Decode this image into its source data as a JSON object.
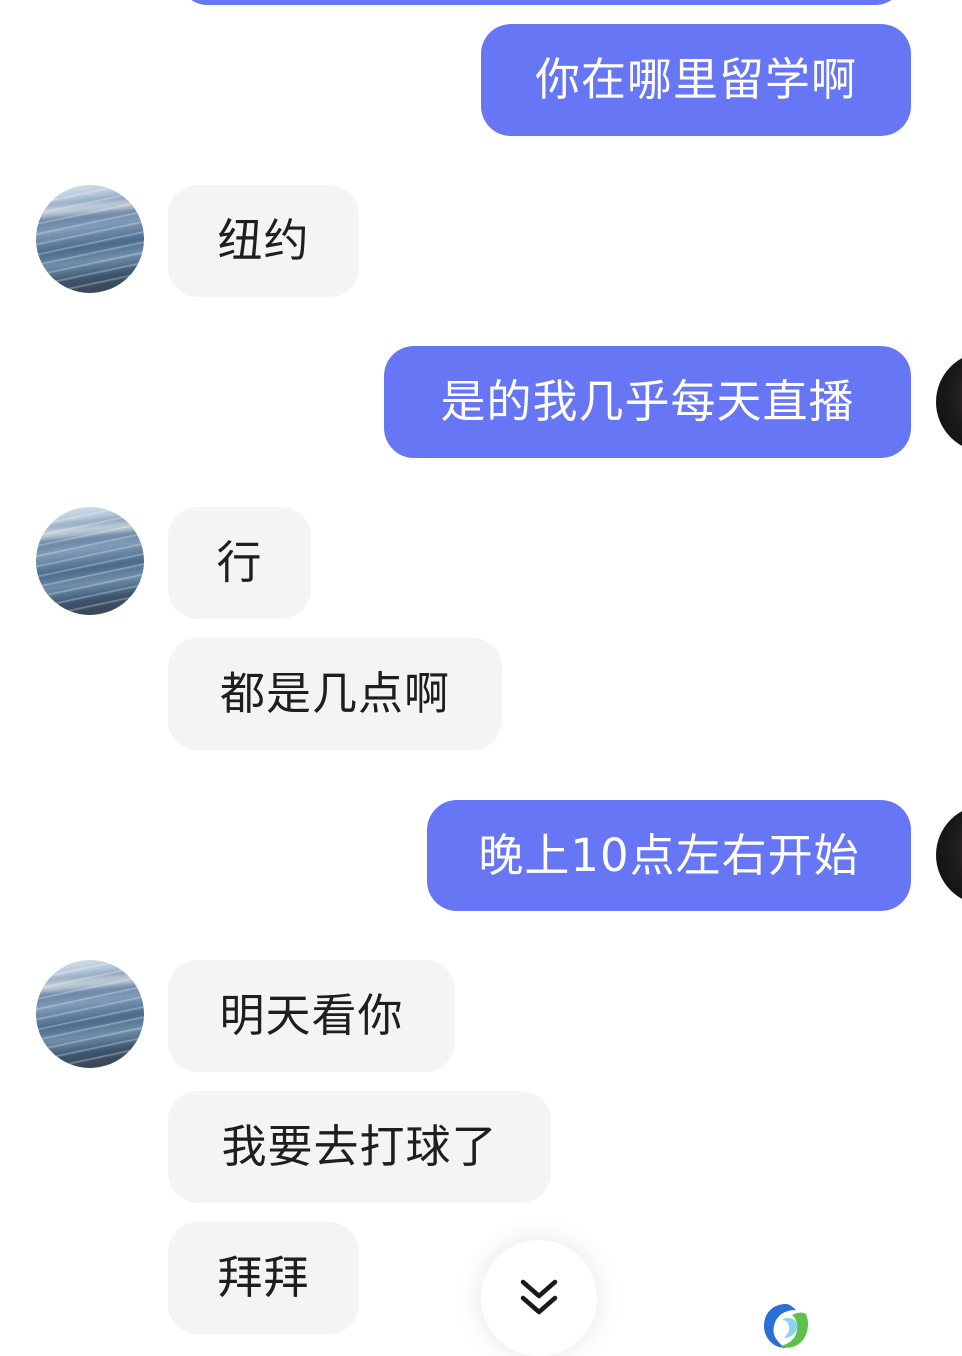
{
  "colors": {
    "sent_bubble": "#6676f5",
    "received_bubble": "#f4f4f6",
    "sent_text": "#ffffff",
    "received_text": "#1e1e1e",
    "background": "#ffffff"
  },
  "messages": [
    {
      "side": "sent",
      "text": "你在哪里留学啊"
    },
    {
      "side": "received",
      "text": "纽约"
    },
    {
      "side": "sent",
      "text": "是的我几乎每天直播"
    },
    {
      "side": "received",
      "text": "行"
    },
    {
      "side": "received",
      "text": "都是几点啊"
    },
    {
      "side": "sent",
      "text": "晚上10点左右开始"
    },
    {
      "side": "received",
      "text": "明天看你"
    },
    {
      "side": "received",
      "text": "我要去打球了"
    },
    {
      "side": "received",
      "text": "拜拜"
    }
  ],
  "icons": {
    "scroll_button": "double-chevron-down-icon",
    "contact_avatar": "ocean-photo-avatar",
    "self_avatar": "portrait-avatar",
    "watermark": "swirl-logo"
  }
}
